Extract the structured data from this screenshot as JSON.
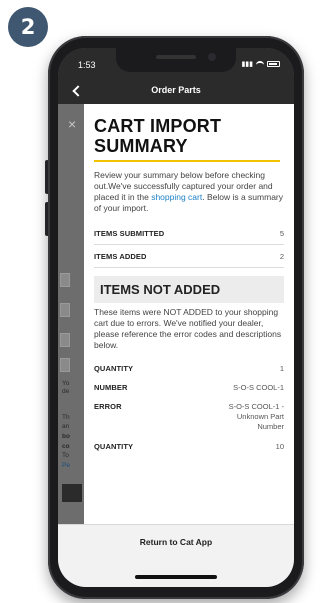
{
  "step": {
    "number": "2"
  },
  "status_bar": {
    "time": "1:53"
  },
  "nav": {
    "title": "Order Parts"
  },
  "background": {
    "close": "×",
    "snippets": [
      "Th",
      "an",
      "bo",
      "co",
      "To",
      "Pe",
      "Yo",
      "de"
    ]
  },
  "modal": {
    "title": "CART IMPORT SUMMARY",
    "intro_before": "Review your summary below before checking out.We've successfully captured your order and placed it in the ",
    "intro_link": "shopping cart",
    "intro_after": ". Below is a summary of your import.",
    "summary": [
      {
        "label": "ITEMS SUBMITTED",
        "value": "5"
      },
      {
        "label": "ITEMS ADDED",
        "value": "2"
      }
    ],
    "not_added_heading": "ITEMS NOT ADDED",
    "not_added_text": "These items were NOT ADDED to your shopping cart due to errors. We've notified your dealer, please reference the error codes and descriptions below.",
    "item1": {
      "quantity_label": "QUANTITY",
      "quantity": "1",
      "number_label": "NUMBER",
      "number": "S-O-S COOL-1",
      "error_label": "ERROR",
      "error": "S-O-S COOL-1 - Unknown Part Number"
    },
    "item2": {
      "quantity_label": "QUANTITY",
      "quantity": "10"
    }
  },
  "footer": {
    "button": "Return to Cat App"
  },
  "colors": {
    "accent": "#f2c200",
    "link": "#1b7fc4",
    "badge": "#3f5770",
    "nav": "#2b2b2b"
  }
}
